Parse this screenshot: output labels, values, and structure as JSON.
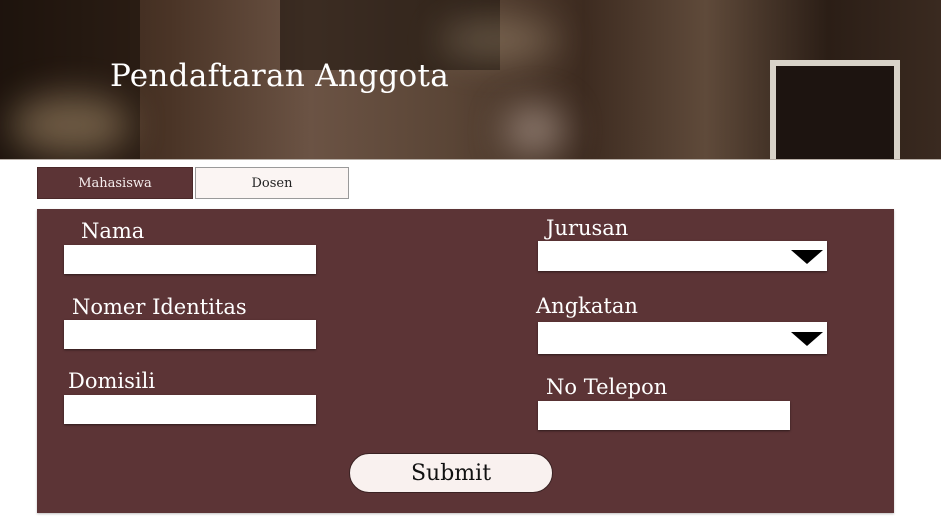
{
  "header": {
    "title": "Pendaftaran Anggota"
  },
  "tabs": [
    {
      "label": "Mahasiswa",
      "active": true
    },
    {
      "label": "Dosen",
      "active": false
    }
  ],
  "form": {
    "nama": {
      "label": "Nama",
      "value": ""
    },
    "nomer_identitas": {
      "label": "Nomer Identitas",
      "value": ""
    },
    "domisili": {
      "label": "Domisili",
      "value": ""
    },
    "jurusan": {
      "label": "Jurusan",
      "selected": ""
    },
    "angkatan": {
      "label": "Angkatan",
      "selected": ""
    },
    "no_telepon": {
      "label": "No Telepon",
      "value": ""
    },
    "submit_label": "Submit"
  },
  "colors": {
    "panel": "#5c3436",
    "tab_active": "#5c3436",
    "tab_inactive": "#fbf5f3",
    "submit_bg": "#f9f1ef"
  },
  "icons": {
    "dropdown": "triangle-down-icon"
  }
}
